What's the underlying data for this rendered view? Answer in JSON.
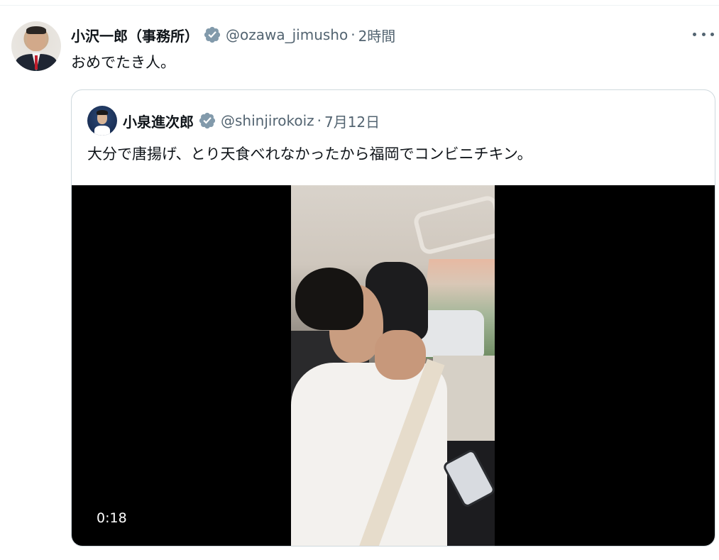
{
  "tweet": {
    "author_name": "小沢一郎（事務所）",
    "handle": "@ozawa_jimusho",
    "separator": "·",
    "time": "2時間",
    "text": "おめでたき人。"
  },
  "quoted": {
    "author_name": "小泉進次郎",
    "handle": "@shinjirokoiz",
    "separator": "·",
    "date": "7月12日",
    "text": "大分で唐揚げ、とり天食べれなかったから福岡でコンビニチキン。",
    "video": {
      "duration": "0:18"
    }
  },
  "icons": {
    "verified": "verified-badge-icon",
    "more": "more-options-icon"
  },
  "colors": {
    "text_primary": "#0f1419",
    "text_secondary": "#536471",
    "border": "#cfd9de",
    "verified_badge": "#829aab"
  }
}
